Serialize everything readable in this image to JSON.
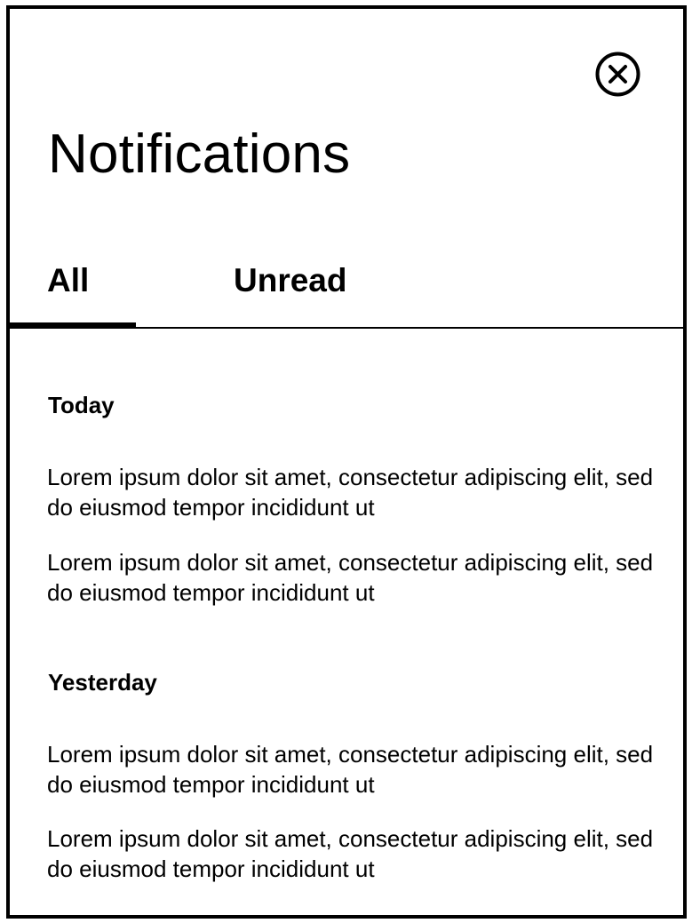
{
  "panel": {
    "title": "Notifications",
    "close_icon": "close-circle-icon"
  },
  "tabs": [
    {
      "label": "All",
      "active": true
    },
    {
      "label": "Unread",
      "active": false
    }
  ],
  "sections": [
    {
      "heading": "Today",
      "items": [
        "Lorem ipsum dolor sit amet, consectetur adipiscing elit, sed do eiusmod tempor incididunt ut",
        "Lorem ipsum dolor sit amet, consectetur adipiscing elit, sed do eiusmod tempor incididunt ut"
      ]
    },
    {
      "heading": "Yesterday",
      "items": [
        "Lorem ipsum dolor sit amet, consectetur adipiscing elit, sed do eiusmod tempor incididunt ut",
        "Lorem ipsum dolor sit amet, consectetur adipiscing elit, sed do eiusmod tempor incididunt ut"
      ]
    }
  ],
  "colors": {
    "foreground": "#000000",
    "background": "#ffffff"
  }
}
